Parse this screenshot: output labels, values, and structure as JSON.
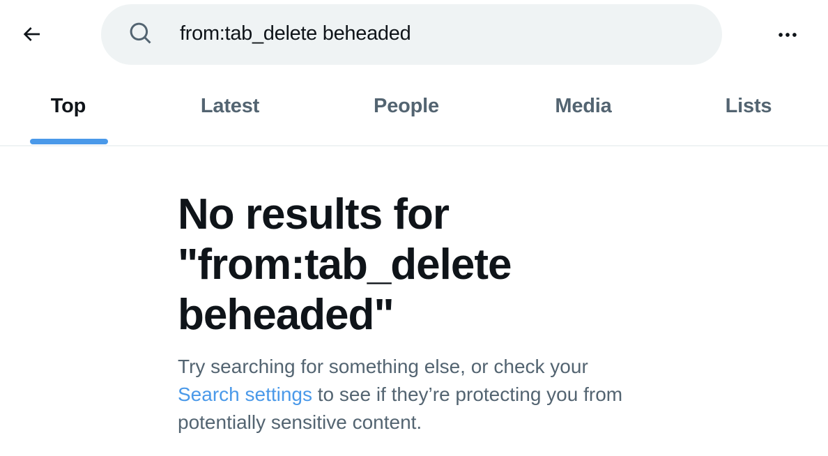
{
  "header": {
    "back_icon": "arrow-left-icon",
    "search": {
      "icon": "search-icon",
      "value": "from:tab_delete beheaded",
      "placeholder": ""
    },
    "more_icon": "ellipsis-icon"
  },
  "tabs": [
    {
      "label": "Top",
      "active": true
    },
    {
      "label": "Latest",
      "active": false
    },
    {
      "label": "People",
      "active": false
    },
    {
      "label": "Media",
      "active": false
    },
    {
      "label": "Lists",
      "active": false
    }
  ],
  "empty_state": {
    "title_line1": "No results for",
    "title_line2": "\"from:tab_delete",
    "title_line3": "beheaded\"",
    "body_prefix": "Try searching for something else, or check your ",
    "link_label": "Search settings",
    "body_suffix": " to see if they’re protecting you from potentially sensitive content."
  },
  "colors": {
    "accent": "#4a99e9",
    "text_primary": "#0f1419",
    "text_secondary": "#536471",
    "search_bg": "#eff3f4"
  }
}
